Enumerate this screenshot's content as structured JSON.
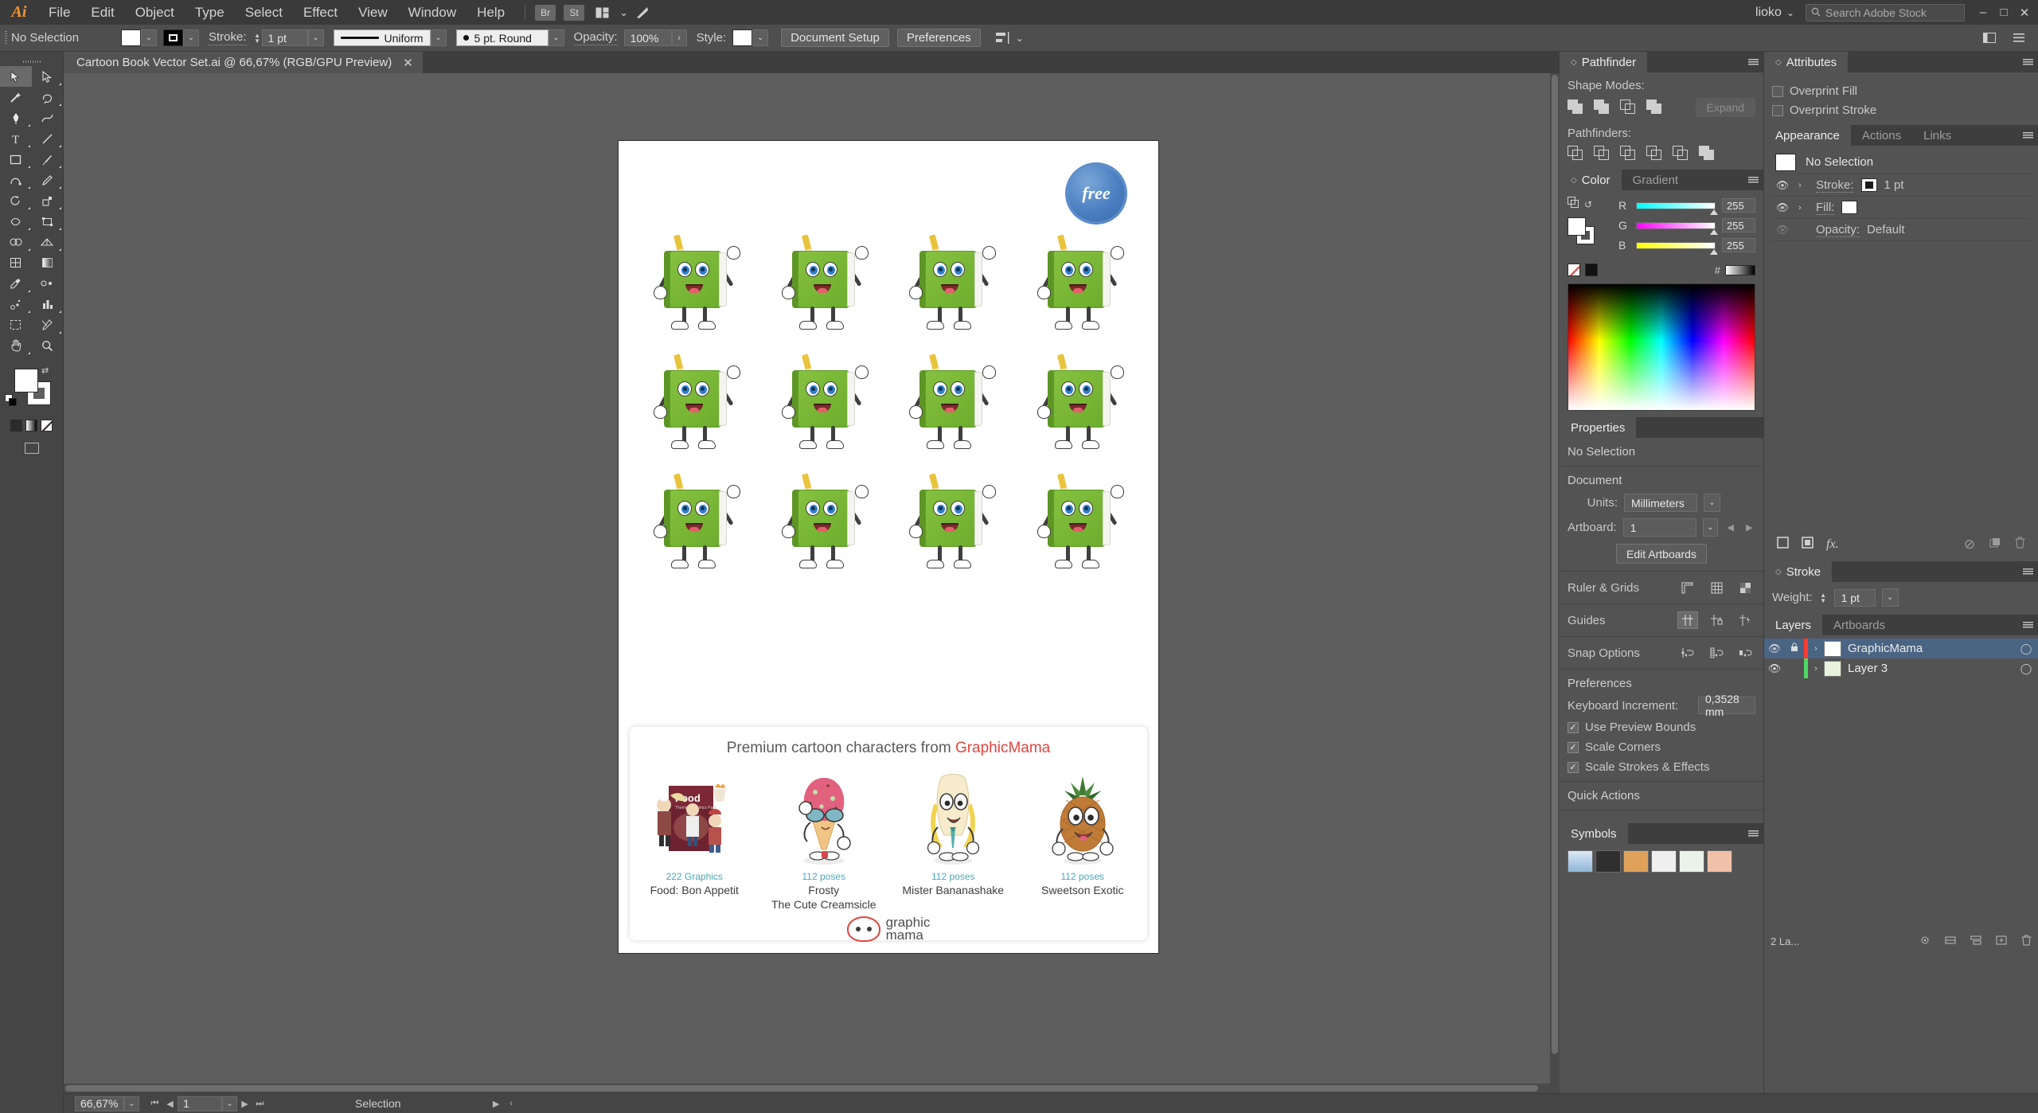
{
  "app": {
    "name": "Adobe Illustrator",
    "logo_text": "Ai"
  },
  "menubar": {
    "items": [
      "File",
      "Edit",
      "Object",
      "Type",
      "Select",
      "Effect",
      "View",
      "Window",
      "Help"
    ],
    "bridge_label": "Br",
    "stock_label": "St",
    "arrange_icon": "arrange-documents-icon",
    "chevron": "⌄",
    "brand_icon": "illustrator-brand-icon",
    "user": "lioko",
    "user_caret": "⌄",
    "search_placeholder": "Search Adobe Stock",
    "search_icon": "search-icon",
    "win_min": "–",
    "win_max": "□",
    "win_close": "✕"
  },
  "controlbar": {
    "selection_status": "No Selection",
    "fill_swatch": "#ffffff",
    "stroke_swatch": "#000000",
    "stroke_label": "Stroke:",
    "stroke_weight": "1 pt",
    "profile_label": "Uniform",
    "brush_label": "5 pt. Round",
    "opacity_label": "Opacity:",
    "opacity_value": "100%",
    "style_label": "Style:",
    "document_setup": "Document Setup",
    "preferences": "Preferences",
    "align_icon": "align-objects-icon",
    "caret": "⌄",
    "arrow_right": "›"
  },
  "tabbar": {
    "doc_title": "Cartoon Book Vector Set.ai @ 66,67%  (RGB/GPU Preview)",
    "close": "✕"
  },
  "toolbar": {
    "tools": [
      "selection-tool",
      "direct-selection-tool",
      "magic-wand-tool",
      "lasso-tool",
      "pen-tool",
      "curvature-tool",
      "type-tool",
      "line-segment-tool",
      "rectangle-tool",
      "paintbrush-tool",
      "shaper-tool",
      "pencil-tool",
      "rotate-tool",
      "scale-tool",
      "width-tool",
      "free-transform-tool",
      "shape-builder-tool",
      "perspective-grid-tool",
      "mesh-tool",
      "gradient-tool",
      "eyedropper-tool",
      "blend-tool",
      "symbol-sprayer-tool",
      "column-graph-tool",
      "artboard-tool",
      "slice-tool",
      "hand-tool",
      "zoom-tool"
    ],
    "fill_color": "#ffffff",
    "stroke_color": "#ffffff",
    "swap_icon": "swap-fill-stroke-icon",
    "default_icon": "default-fill-stroke-icon",
    "fill_modes": [
      "color-fill-mode",
      "gradient-fill-mode",
      "none-fill-mode"
    ],
    "screen_mode": "change-screen-mode-icon"
  },
  "canvas": {
    "artboard": {
      "badge_text": "free",
      "rows": [
        [
          "book-character-1",
          "book-character-2",
          "book-character-3",
          "book-character-4"
        ],
        [
          "book-character-5",
          "book-character-6",
          "book-character-7",
          "book-character-8"
        ],
        [
          "book-character-9",
          "book-character-10",
          "book-character-11",
          "book-character-12"
        ]
      ],
      "promo": {
        "title_prefix": "Premium cartoon characters from ",
        "title_brand": "GraphicMama",
        "cards": [
          {
            "count": "222 Graphics",
            "name": "Food: Bon Appetit",
            "art": "food-bundle-art"
          },
          {
            "count": "112 poses",
            "name": "Frosty\nThe Cute Creamsicle",
            "art": "ice-cream-character-art"
          },
          {
            "count": "112 poses",
            "name": "Mister Bananashake",
            "art": "banana-character-art"
          },
          {
            "count": "112 poses",
            "name": "Sweetson Exotic",
            "art": "pineapple-character-art"
          }
        ],
        "logo_line1": "graphic",
        "logo_line2": "mama"
      }
    }
  },
  "statusbar": {
    "zoom": "66,67%",
    "artboard_number": "1",
    "tool_status": "Selection",
    "caret": "⌄",
    "first": "⏮",
    "prev": "◀",
    "next": "▶",
    "last": "⏭",
    "play": "▶",
    "arrow": "‹"
  },
  "panels": {
    "pathfinder": {
      "tab": "Pathfinder",
      "shape_modes_label": "Shape Modes:",
      "shape_modes": [
        "unite-icon",
        "minus-front-icon",
        "intersect-icon",
        "exclude-icon"
      ],
      "expand_label": "Expand",
      "pathfinders_label": "Pathfinders:",
      "pathfinders": [
        "divide-icon",
        "trim-icon",
        "merge-icon",
        "crop-icon",
        "outline-icon",
        "minus-back-icon"
      ]
    },
    "color": {
      "tabs": [
        "Color",
        "Gradient"
      ],
      "active_tab": "Color",
      "channels": [
        {
          "label": "R",
          "value": "255"
        },
        {
          "label": "G",
          "value": "255"
        },
        {
          "label": "B",
          "value": "255"
        }
      ],
      "hex_symbol": "#",
      "none_swatch": "none-swatch",
      "black_swatch": "#000000",
      "white_swatch": "#ffffff"
    },
    "properties": {
      "tab": "Properties",
      "no_selection": "No Selection",
      "document_label": "Document",
      "units_label": "Units:",
      "units_value": "Millimeters",
      "artboard_label": "Artboard:",
      "artboard_value": "1",
      "edit_artboards": "Edit Artboards",
      "ruler_grids_label": "Ruler & Grids",
      "ruler_icons": [
        "show-rulers-icon",
        "show-grid-icon",
        "show-transparency-grid-icon"
      ],
      "guides_label": "Guides",
      "guides_icons": [
        "show-guides-icon",
        "lock-guides-icon",
        "smart-guides-icon"
      ],
      "snap_label": "Snap Options",
      "snap_icons": [
        "snap-to-point-icon",
        "snap-to-grid-icon",
        "snap-to-pixel-icon"
      ],
      "preferences_label": "Preferences",
      "keyboard_increment_label": "Keyboard Increment:",
      "keyboard_increment_value": "0,3528 mm",
      "checkboxes": [
        {
          "label": "Use Preview Bounds",
          "checked": true
        },
        {
          "label": "Scale Corners",
          "checked": true
        },
        {
          "label": "Scale Strokes & Effects",
          "checked": true
        }
      ],
      "quick_actions_label": "Quick Actions",
      "caret": "⌄",
      "check": "✓"
    },
    "symbols": {
      "tab": "Symbols",
      "count": 6
    },
    "attributes": {
      "tab": "Attributes",
      "overprint_fill": "Overprint Fill",
      "overprint_stroke": "Overprint Stroke"
    },
    "appearance": {
      "tabs": [
        "Appearance",
        "Actions",
        "Links"
      ],
      "active_tab": "Appearance",
      "target": "No Selection",
      "stroke_label": "Stroke:",
      "stroke_value": "1 pt",
      "fill_label": "Fill:",
      "opacity_label": "Opacity:",
      "opacity_value": "Default",
      "eye_icon": "visibility-eye-icon",
      "chevron": "›",
      "fx_label": "fx.",
      "bottom_icons": [
        "add-new-stroke-icon",
        "add-new-fill-icon",
        "add-fx-icon",
        "clear-appearance-icon",
        "duplicate-item-icon",
        "delete-item-icon"
      ]
    },
    "stroke": {
      "tab": "Stroke",
      "weight_label": "Weight:",
      "weight_value": "1 pt",
      "caret": "⌄"
    },
    "layers": {
      "tabs": [
        "Layers",
        "Artboards"
      ],
      "active_tab": "Layers",
      "rows": [
        {
          "name": "GraphicMama",
          "color": "#ff3b30",
          "locked": true,
          "visible": true,
          "selected": true
        },
        {
          "name": "Layer 3",
          "color": "#4cd964",
          "locked": false,
          "visible": true,
          "selected": false
        }
      ],
      "count_label": "2 La...",
      "eye_icon": "visibility-eye-icon",
      "lock_icon": "lock-icon",
      "chevron": "›",
      "target_icon": "target-circle-icon",
      "foot_icons": [
        "locate-object-icon",
        "make-clipping-mask-icon",
        "create-sublayer-icon",
        "create-new-layer-icon",
        "delete-layer-icon"
      ]
    }
  }
}
